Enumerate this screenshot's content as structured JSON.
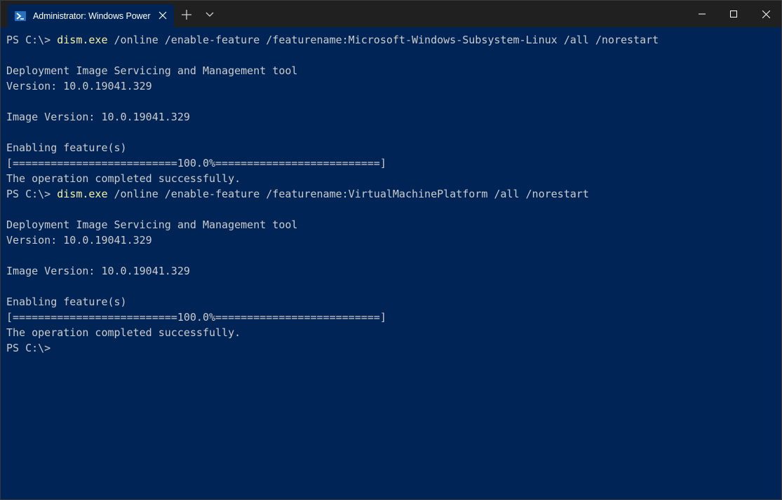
{
  "titlebar": {
    "tab_title": "Administrator: Windows PowerShell",
    "icons": {
      "tab_icon": "powershell-icon",
      "close_tab": "close-icon",
      "new_tab": "plus-icon",
      "dropdown": "chevron-down-icon",
      "minimize": "minimize-icon",
      "maximize": "maximize-icon",
      "close_window": "close-icon"
    }
  },
  "colors": {
    "background": "#012456",
    "text": "#cccccc",
    "command": "#f9f1a5",
    "titlebar": "#202020"
  },
  "terminal": {
    "lines": [
      {
        "prompt": "PS C:\\> ",
        "cmd": "dism.exe",
        "args": " /online /enable-feature /featurename:Microsoft-Windows-Subsystem-Linux /all /norestart"
      },
      {
        "text": ""
      },
      {
        "text": "Deployment Image Servicing and Management tool"
      },
      {
        "text": "Version: 10.0.19041.329"
      },
      {
        "text": ""
      },
      {
        "text": "Image Version: 10.0.19041.329"
      },
      {
        "text": ""
      },
      {
        "text": "Enabling feature(s)"
      },
      {
        "text": "[==========================100.0%==========================]"
      },
      {
        "text": "The operation completed successfully."
      },
      {
        "prompt": "PS C:\\> ",
        "cmd": "dism.exe",
        "args": " /online /enable-feature /featurename:VirtualMachinePlatform /all /norestart"
      },
      {
        "text": ""
      },
      {
        "text": "Deployment Image Servicing and Management tool"
      },
      {
        "text": "Version: 10.0.19041.329"
      },
      {
        "text": ""
      },
      {
        "text": "Image Version: 10.0.19041.329"
      },
      {
        "text": ""
      },
      {
        "text": "Enabling feature(s)"
      },
      {
        "text": "[==========================100.0%==========================]"
      },
      {
        "text": "The operation completed successfully."
      },
      {
        "prompt": "PS C:\\>",
        "cmd": "",
        "args": ""
      }
    ]
  }
}
